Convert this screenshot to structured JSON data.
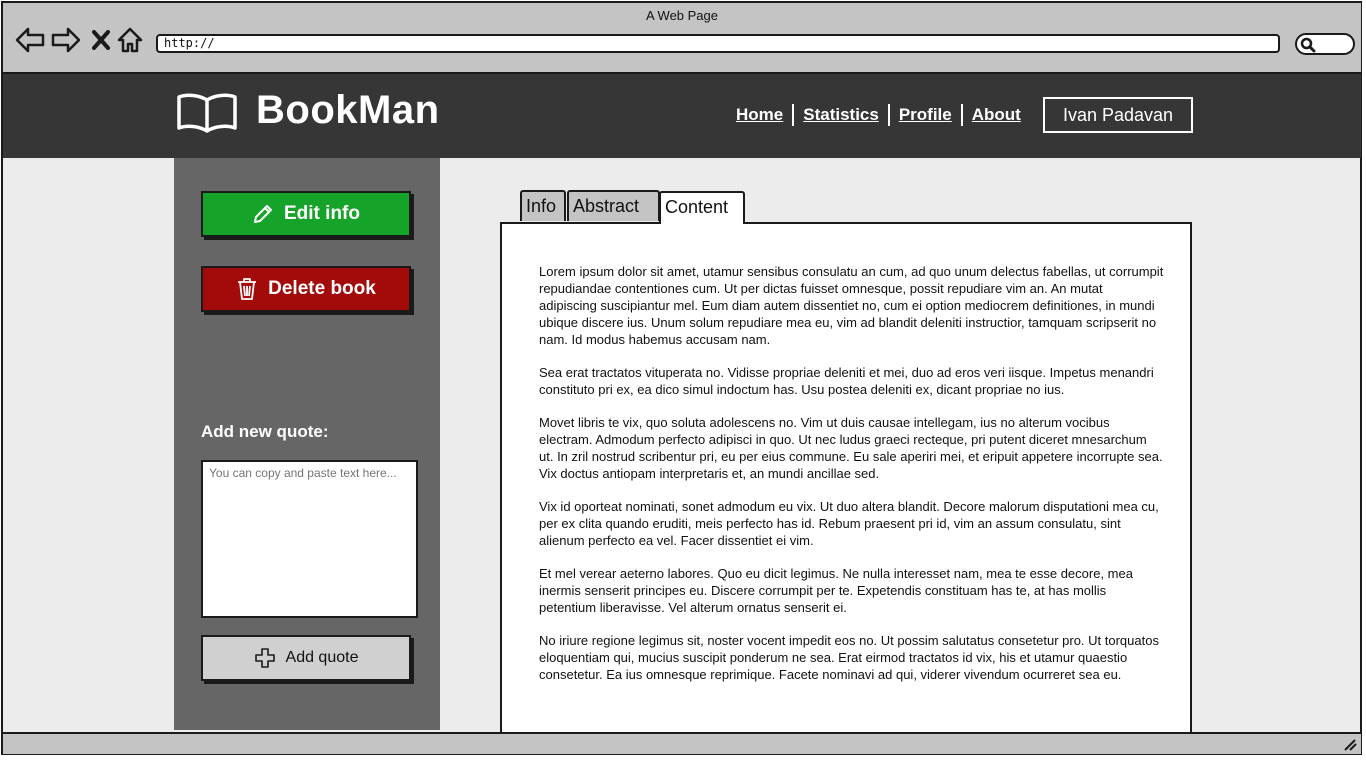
{
  "browser": {
    "title": "A Web Page",
    "url": "http://"
  },
  "header": {
    "logo_text": "BookMan",
    "nav": [
      {
        "label": "Home"
      },
      {
        "label": "Statistics"
      },
      {
        "label": "Profile"
      },
      {
        "label": "About"
      }
    ],
    "user_name": "Ivan Padavan"
  },
  "sidebar": {
    "edit_label": "Edit info",
    "delete_label": "Delete book",
    "quote_label": "Add new quote:",
    "quote_placeholder": "You can copy and paste text here...",
    "add_quote_label": "Add quote"
  },
  "tabs": [
    {
      "label": "Info"
    },
    {
      "label": "Abstract"
    },
    {
      "label": "Content",
      "active": true
    }
  ],
  "content": {
    "paragraphs": [
      "Lorem ipsum dolor sit amet, utamur sensibus consulatu an cum, ad quo unum delectus fabellas, ut corrumpit repudiandae contentiones cum. Ut per dictas fuisset omnesque, possit repudiare vim an. An mutat adipiscing suscipiantur mel. Eum diam autem dissentiet no, cum ei option mediocrem definitiones, in mundi ubique discere ius. Unum solum repudiare mea eu, vim ad blandit deleniti instructior, tamquam scripserit no nam. Id modus habemus accusam nam.",
      "Sea erat tractatos vituperata no. Vidisse propriae deleniti et mei, duo ad eros veri iisque. Impetus menandri constituto pri ex, ea dico simul indoctum has. Usu postea deleniti ex, dicant propriae no ius.",
      "Movet libris te vix, quo soluta adolescens no. Vim ut duis causae intellegam, ius no alterum vocibus electram. Admodum perfecto adipisci in quo. Ut nec ludus graeci recteque, pri putent diceret mnesarchum ut. In zril nostrud scribentur pri, eu per eius commune. Eu sale aperiri mei, et eripuit appetere incorrupte sea. Vix doctus antiopam interpretaris et, an mundi ancillae sed.",
      "Vix id oporteat nominati, sonet admodum eu vix. Ut duo altera blandit. Decore malorum disputationi mea cu, per ex clita quando eruditi, meis perfecto has id. Rebum praesent pri id, vim an assum consulatu, sint alienum perfecto ea vel. Facer dissentiet ei vim.",
      "Et mel verear aeterno labores. Quo eu dicit legimus. Ne nulla interesset nam, mea te esse decore, mea inermis senserit principes eu. Discere corrumpit per te. Expetendis constituam has te, at has mollis petentium liberavisse. Vel alterum ornatus senserit ei.",
      "No iriure regione legimus sit, noster vocent impedit eos no. Ut possim salutatus consetetur pro. Ut torquatos eloquentiam qui, mucius suscipit ponderum ne sea. Erat eirmod tractatos id vix, his et utamur quaestio consetetur. Ea ius omnesque reprimique. Facete nominavi ad qui, viderer vivendum ocurreret sea eu."
    ]
  },
  "colors": {
    "header_bg": "#363636",
    "sidebar_bg": "#666666",
    "edit_button": "#16a329",
    "delete_button": "#a30a0a"
  },
  "icons": {
    "back": "arrow-left-icon",
    "forward": "arrow-right-icon",
    "stop": "close-icon",
    "home": "home-icon",
    "search": "search-icon",
    "logo": "book-icon",
    "edit": "pencil-icon",
    "delete": "trash-icon",
    "add": "plus-icon",
    "resize": "resize-grip-icon"
  }
}
